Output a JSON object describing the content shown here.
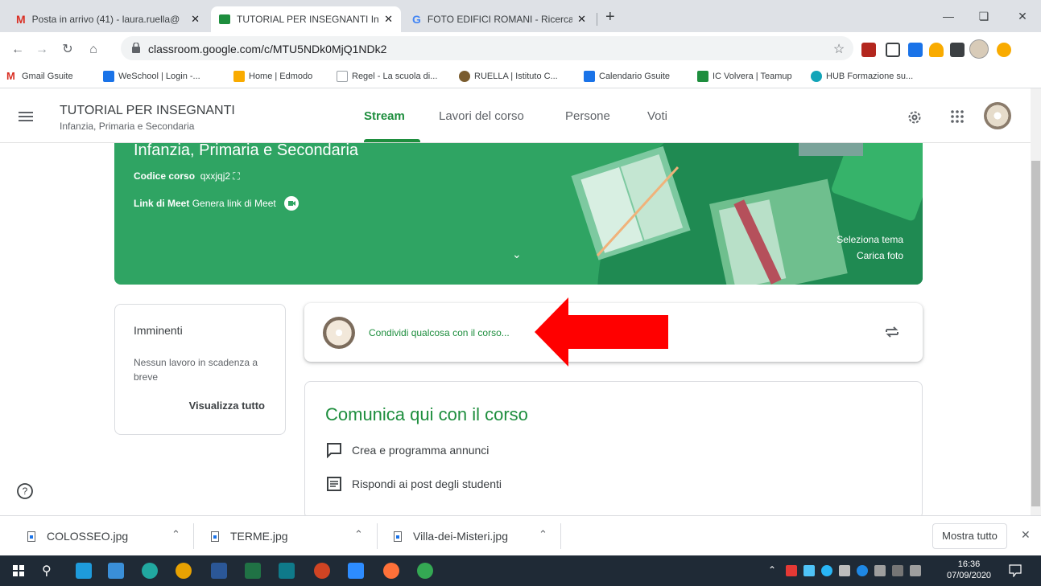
{
  "browser": {
    "tabs": [
      {
        "title": "Posta in arrivo (41) - laura.ruella@",
        "close": "✕",
        "active": false
      },
      {
        "title": "TUTORIAL PER INSEGNANTI Infar",
        "close": "✕",
        "active": true
      },
      {
        "title": "FOTO EDIFICI ROMANI - Ricerca",
        "close": "✕",
        "active": false
      }
    ],
    "new_tab": "+",
    "url": "classroom.google.com/c/MTU5NDk0MjQ1NDk2",
    "bookmarks": [
      "Gmail Gsuite",
      "WeSchool | Login -...",
      "Home | Edmodo",
      "Regel - La scuola di...",
      "RUELLA | Istituto C...",
      "Calendario Gsuite",
      "IC Volvera | Teamup",
      "HUB Formazione su..."
    ]
  },
  "classroom": {
    "course_title": "TUTORIAL PER INSEGNANTI",
    "course_subtitle": "Infanzia, Primaria e Secondaria",
    "tabs": [
      "Stream",
      "Lavori del corso",
      "Persone",
      "Voti"
    ],
    "banner": {
      "heading": "Infanzia, Primaria e Secondaria",
      "code_label": "Codice corso",
      "code_value": "qxxjqj2",
      "meet_label": "Link di Meet",
      "meet_value": "Genera link di Meet",
      "select_theme": "Seleziona tema",
      "upload_photo": "Carica foto"
    },
    "upcoming": {
      "title": "Imminenti",
      "empty": "Nessun lavoro in scadenza a breve",
      "view_all": "Visualizza tutto"
    },
    "share_prompt": "Condividi qualcosa con il corso...",
    "communicate": {
      "title": "Comunica qui con il corso",
      "items": [
        "Crea e programma annunci",
        "Rispondi ai post degli studenti"
      ]
    }
  },
  "downloads": {
    "files": [
      "COLOSSEO.jpg",
      "TERME.jpg",
      "Villa-dei-Misteri.jpg"
    ],
    "show_all": "Mostra tutto"
  },
  "taskbar": {
    "time": "16:36",
    "date": "07/09/2020"
  },
  "colors": {
    "accent_green": "#1e8e3e",
    "banner_green": "#2fa463",
    "arrow_red": "#ff0000"
  }
}
